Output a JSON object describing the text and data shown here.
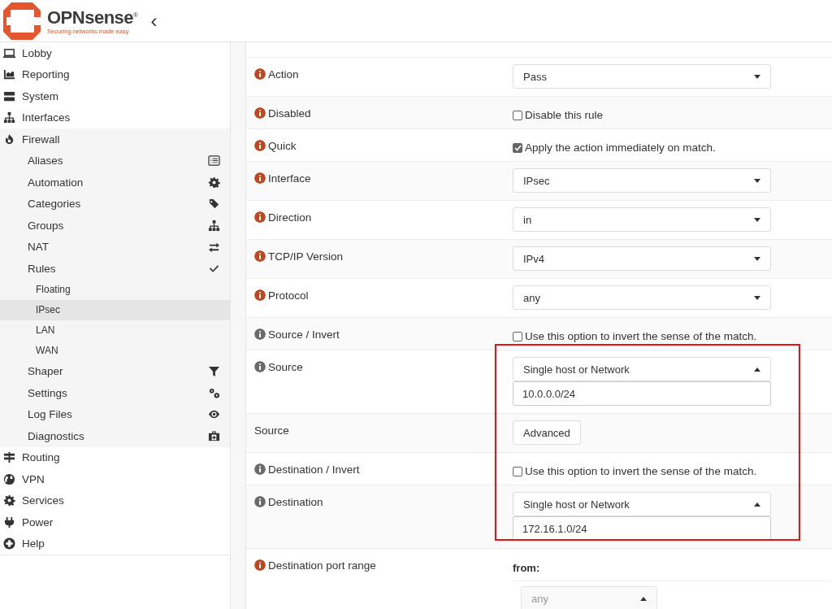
{
  "header": {
    "brand": "OPNsense",
    "registered": "®",
    "tagline": "Securing networks made easy",
    "collapse": "‹"
  },
  "sidebar": {
    "items": [
      {
        "label": "Lobby",
        "selected": false
      },
      {
        "label": "Reporting",
        "selected": false
      },
      {
        "label": "System",
        "selected": false
      },
      {
        "label": "Interfaces",
        "selected": false
      },
      {
        "label": "Firewall",
        "selected": false,
        "expanded": true,
        "children": [
          {
            "label": "Aliases",
            "selected": false
          },
          {
            "label": "Automation",
            "selected": false
          },
          {
            "label": "Categories",
            "selected": false
          },
          {
            "label": "Groups",
            "selected": false
          },
          {
            "label": "NAT",
            "selected": false
          },
          {
            "label": "Rules",
            "selected": false,
            "expanded": true,
            "children": [
              {
                "label": "Floating",
                "selected": false
              },
              {
                "label": "IPsec",
                "selected": true
              },
              {
                "label": "LAN",
                "selected": false
              },
              {
                "label": "WAN",
                "selected": false
              }
            ]
          },
          {
            "label": "Shaper",
            "selected": false
          },
          {
            "label": "Settings",
            "selected": false
          },
          {
            "label": "Log Files",
            "selected": false
          },
          {
            "label": "Diagnostics",
            "selected": false
          }
        ]
      },
      {
        "label": "Routing",
        "selected": false
      },
      {
        "label": "VPN",
        "selected": false
      },
      {
        "label": "Services",
        "selected": false
      },
      {
        "label": "Power",
        "selected": false
      },
      {
        "label": "Help",
        "selected": false
      }
    ]
  },
  "form": {
    "rows": [
      {
        "label": "Action",
        "info": true,
        "color": "#c0461b",
        "kind": "select",
        "value": "Pass"
      },
      {
        "label": "Disabled",
        "info": true,
        "color": "#c0461b",
        "kind": "checkbox",
        "text": "Disable this rule",
        "checked": false
      },
      {
        "label": "Quick",
        "info": true,
        "color": "#c0461b",
        "kind": "checkbox",
        "text": "Apply the action immediately on match.",
        "checked": true
      },
      {
        "label": "Interface",
        "info": true,
        "color": "#c0461b",
        "kind": "select",
        "value": "IPsec"
      },
      {
        "label": "Direction",
        "info": true,
        "color": "#c0461b",
        "kind": "select",
        "value": "in"
      },
      {
        "label": "TCP/IP Version",
        "info": true,
        "color": "#c0461b",
        "kind": "select",
        "value": "IPv4"
      },
      {
        "label": "Protocol",
        "info": true,
        "color": "#c0461b",
        "kind": "select",
        "value": "any"
      },
      {
        "label": "Source / Invert",
        "info": true,
        "color": "#6b6b6b",
        "kind": "checkbox",
        "text": "Use this option to invert the sense of the match.",
        "checked": false
      },
      {
        "label": "Source",
        "info": true,
        "color": "#6b6b6b",
        "kind": "address",
        "value": "Single host or Network",
        "address": "10.0.0.0/24"
      },
      {
        "label": "Source",
        "info": false,
        "kind": "button",
        "text": "Advanced"
      },
      {
        "label": "Destination / Invert",
        "info": true,
        "color": "#6b6b6b",
        "kind": "checkbox",
        "text": "Use this option to invert the sense of the match.",
        "checked": false
      },
      {
        "label": "Destination",
        "info": true,
        "color": "#6b6b6b",
        "kind": "address",
        "value": "Single host or Network",
        "address": "172.16.1.0/24"
      },
      {
        "label": "Destination port range",
        "info": true,
        "color": "#c0461b",
        "kind": "portrange",
        "from_label": "from:",
        "value": "any",
        "disabled": true
      }
    ]
  }
}
